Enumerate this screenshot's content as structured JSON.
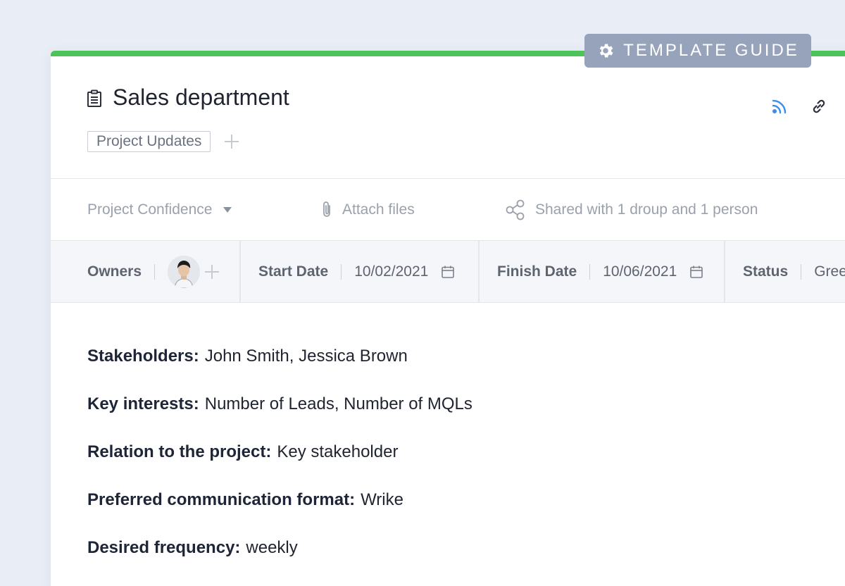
{
  "badge": {
    "label": "TEMPLATE GUIDE",
    "icon": "gear-icon"
  },
  "header": {
    "title": "Sales department",
    "tag": "Project Updates",
    "icons": [
      "document-icon",
      "rss-icon",
      "link-icon",
      "plus-icon"
    ]
  },
  "actions": {
    "confidence": "Project Confidence",
    "attach": "Attach files",
    "shared": "Shared with 1 droup and 1 person"
  },
  "fields": {
    "owners_label": "Owners",
    "start_label": "Start Date",
    "start_value": "10/02/2021",
    "finish_label": "Finish Date",
    "finish_value": "10/06/2021",
    "status_label": "Status",
    "status_value": "Gree"
  },
  "details": [
    {
      "label": "Stakeholders:",
      "value": "John Smith, Jessica Brown"
    },
    {
      "label": "Key interests:",
      "value": "Number of Leads, Number of MQLs"
    },
    {
      "label": "Relation to the project:",
      "value": "Key stakeholder"
    },
    {
      "label": "Preferred communication format:",
      "value": "Wrike"
    },
    {
      "label": "Desired frequency:",
      "value": "weekly"
    }
  ],
  "colors": {
    "accent_bar": "#4ec35a",
    "badge_bg": "#97a3ba",
    "rss_blue": "#3b8df0",
    "background": "#e9edf5"
  }
}
